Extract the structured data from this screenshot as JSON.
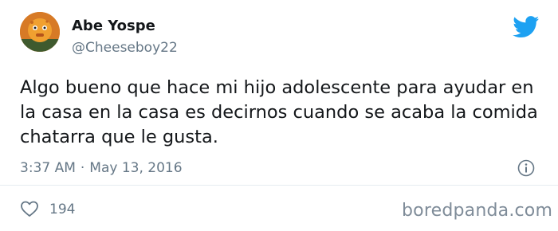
{
  "author": {
    "name": "Abe Yospe",
    "handle": "@Cheeseboy22",
    "avatar_icon": "cheese-character-avatar"
  },
  "tweet": {
    "lines": [
      "Algo bueno que hace mi hijo adolescente para ayudar en",
      "la casa en la casa es decirnos cuando se acaba la comida",
      "chatarra que le gusta."
    ]
  },
  "meta": {
    "time": "3:37 AM",
    "separator": "·",
    "date": "May 13, 2016"
  },
  "actions": {
    "like_count": "194"
  },
  "icons": {
    "brand": "twitter-bird-icon",
    "info": "info-icon",
    "like": "heart-icon"
  },
  "watermark": "boredpanda.com",
  "colors": {
    "brand": "#1da1f2",
    "text": "#14171a",
    "muted": "#657786",
    "divider": "#e6ecf0"
  }
}
